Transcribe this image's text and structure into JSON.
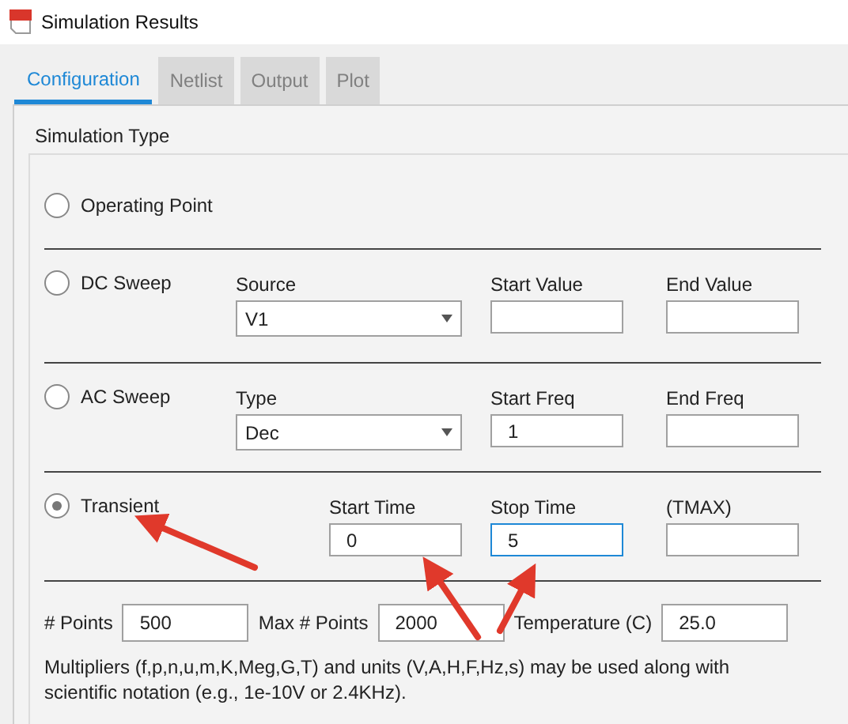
{
  "window": {
    "title": "Simulation Results"
  },
  "tabs": [
    {
      "label": "Configuration",
      "selected": true
    },
    {
      "label": "Netlist",
      "selected": false
    },
    {
      "label": "Output",
      "selected": false
    },
    {
      "label": "Plot",
      "selected": false
    }
  ],
  "group_label": "Simulation Type",
  "simulation_types": [
    {
      "label": "Operating Point",
      "selected": false
    },
    {
      "label": "DC Sweep",
      "selected": false,
      "fields": [
        {
          "kind": "dropdown",
          "label": "Source",
          "value": "V1"
        },
        {
          "kind": "input",
          "label": "Start Value",
          "focused": false
        },
        {
          "kind": "input",
          "label": "End Value",
          "focused": false
        }
      ]
    },
    {
      "label": "AC Sweep",
      "selected": false,
      "fields": [
        {
          "kind": "dropdown",
          "label": "Type",
          "value": "Dec"
        },
        {
          "kind": "input",
          "label": "Start Freq",
          "value": "1",
          "focused": false
        },
        {
          "kind": "input",
          "label": "End Freq",
          "focused": false
        }
      ]
    },
    {
      "label": "Transient",
      "selected": true,
      "fields": [
        {
          "kind": "input",
          "label": "Start Time",
          "value": "0",
          "focused": false
        },
        {
          "kind": "input",
          "label": "Stop Time",
          "value": "5",
          "focused": true
        },
        {
          "kind": "input",
          "label": "(TMAX)",
          "focused": false
        }
      ]
    }
  ],
  "options": [
    {
      "label": "# Points",
      "value": "500"
    },
    {
      "label": "Max # Points",
      "value": "2000"
    },
    {
      "label": "Temperature (C)",
      "value": "25.0"
    }
  ],
  "note": "Multipliers (f,p,n,u,m,K,Meg,G,T) and units (V,A,H,F,Hz,s) may be used along with scientific notation (e.g., 1e-10V or 2.4KHz)."
}
